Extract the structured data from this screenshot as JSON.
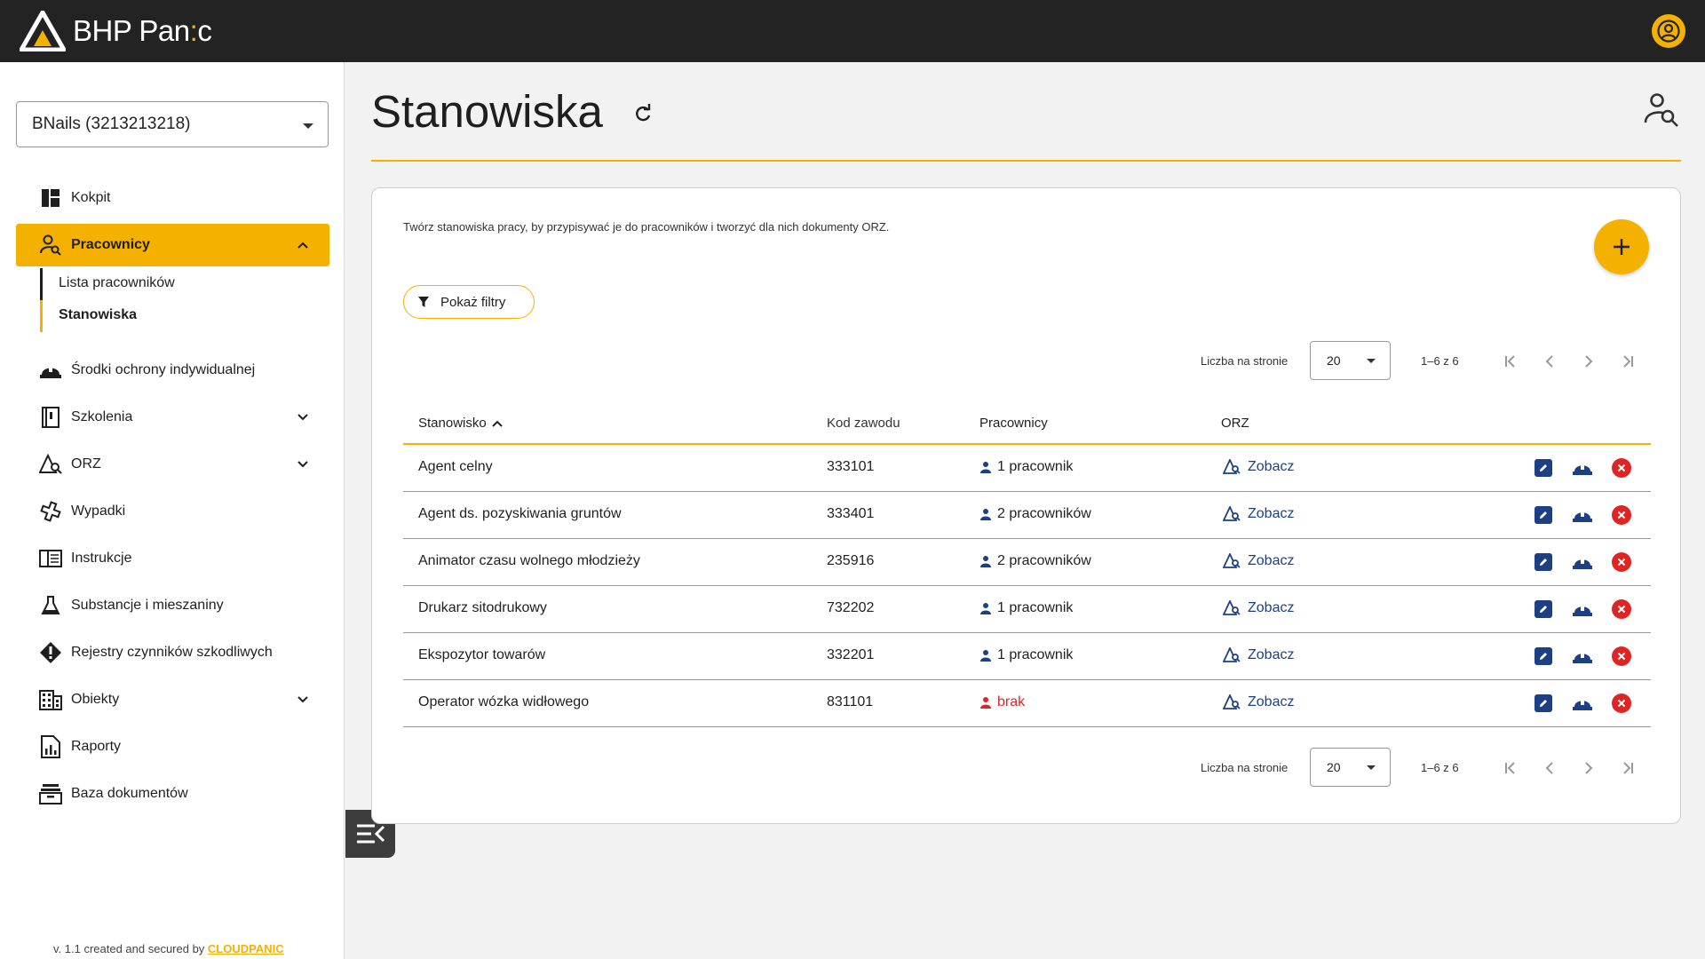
{
  "app": {
    "logo_text_before": "BHP Pan",
    "logo_colon": ":",
    "logo_text_after": "c"
  },
  "sidebar": {
    "company": "BNails (3213213218)",
    "items": [
      {
        "label": "Kokpit",
        "icon": "dashboard-icon"
      },
      {
        "label": "Pracownicy",
        "icon": "employee-search-icon",
        "active": true,
        "expanded": true
      },
      {
        "label": "Środki ochrony indywidualnej",
        "icon": "helmet-icon"
      },
      {
        "label": "Szkolenia",
        "icon": "book-icon",
        "expandable": true
      },
      {
        "label": "ORZ",
        "icon": "risk-icon",
        "expandable": true
      },
      {
        "label": "Wypadki",
        "icon": "medical-icon"
      },
      {
        "label": "Instrukcje",
        "icon": "instruction-icon"
      },
      {
        "label": "Substancje i mieszaniny",
        "icon": "flask-icon"
      },
      {
        "label": "Rejestry czynników szkodliwych",
        "icon": "warning-icon"
      },
      {
        "label": "Obiekty",
        "icon": "building-icon",
        "expandable": true
      },
      {
        "label": "Raporty",
        "icon": "report-icon"
      },
      {
        "label": "Baza dokumentów",
        "icon": "archive-icon"
      }
    ],
    "sub_items": [
      "Lista pracowników",
      "Stanowiska"
    ],
    "footer_prefix": "v. 1.1 created and secured by ",
    "footer_brand": "CLOUDPANIC"
  },
  "main": {
    "title": "Stanowiska",
    "description": "Twórz stanowiska pracy, by przypisywać je do pracowników i tworzyć dla nich dokumenty ORZ.",
    "filter_label": "Pokaż filtry",
    "pager": {
      "label": "Liczba na stronie",
      "per_page": "20",
      "range": "1–6 z 6"
    },
    "table": {
      "headers": [
        "Stanowisko",
        "Kod zawodu",
        "Pracownicy",
        "ORZ"
      ],
      "rows": [
        {
          "name": "Agent celny",
          "code": "333101",
          "employees": "1 pracownik",
          "orz": "Zobacz"
        },
        {
          "name": "Agent ds. pozyskiwania gruntów",
          "code": "333401",
          "employees": "2 pracowników",
          "orz": "Zobacz"
        },
        {
          "name": "Animator czasu wolnego młodzieży",
          "code": "235916",
          "employees": "2 pracowników",
          "orz": "Zobacz"
        },
        {
          "name": "Drukarz sitodrukowy",
          "code": "732202",
          "employees": "1 pracownik",
          "orz": "Zobacz"
        },
        {
          "name": "Ekspozytor towarów",
          "code": "332201",
          "employees": "1 pracownik",
          "orz": "Zobacz"
        },
        {
          "name": "Operator wózka widłowego",
          "code": "831101",
          "employees": "brak",
          "orz": "Zobacz"
        }
      ]
    }
  },
  "colors": {
    "accent": "#f5b100",
    "topbar": "#232323",
    "link": "#1d3f83",
    "danger": "#e02424"
  }
}
